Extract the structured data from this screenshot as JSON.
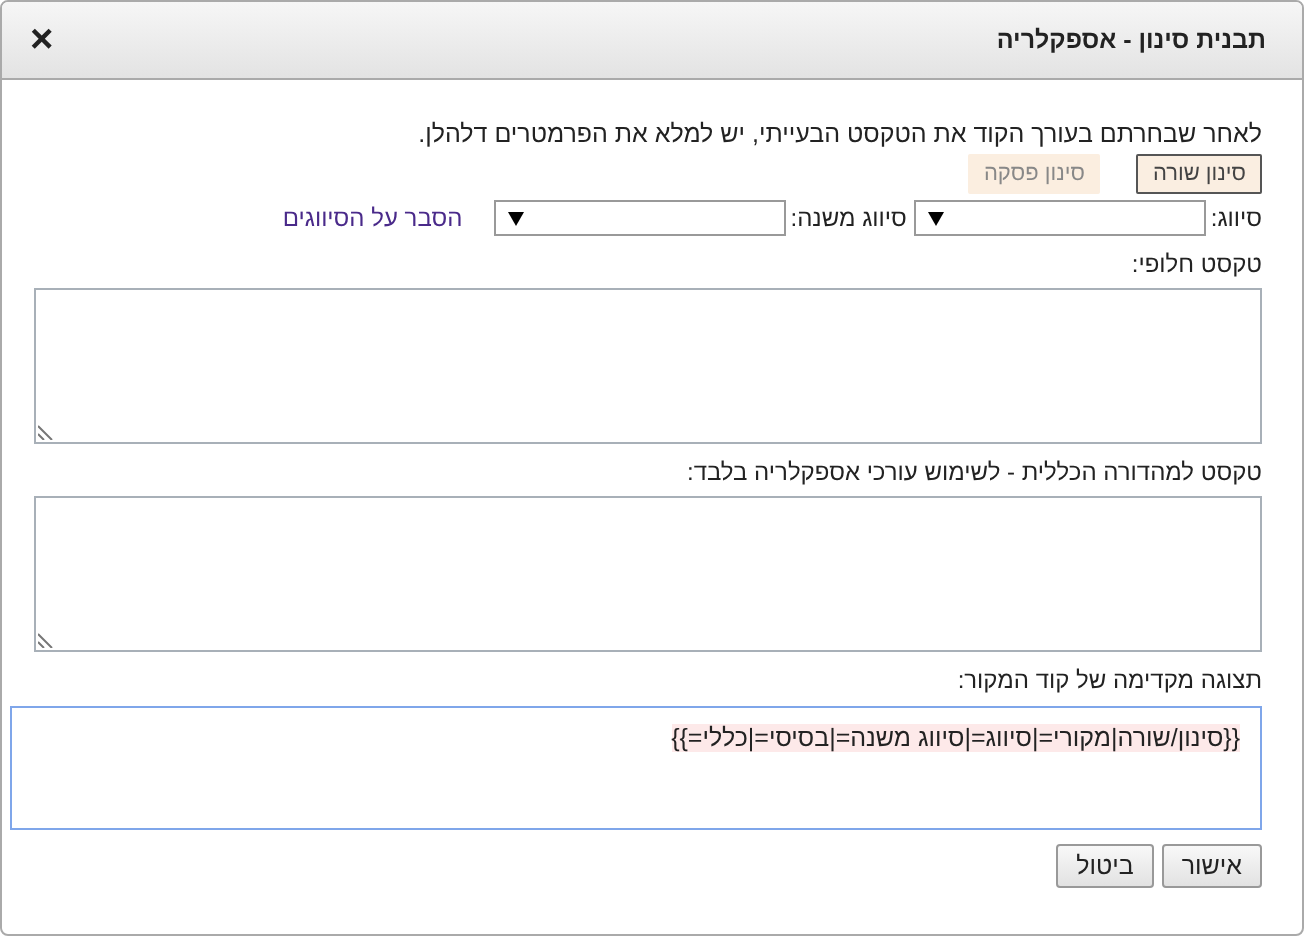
{
  "window": {
    "title": "תבנית סינון - אספקלריה",
    "close": "×"
  },
  "instructions": "לאחר שבחרתם בעורך הקוד את הטקסט הבעייתי, יש למלא את הפרמטרים דלהלן.",
  "modes": [
    {
      "label": "סינון שורה",
      "selected": true
    },
    {
      "label": "סינון פסקה",
      "selected": false
    }
  ],
  "classification": {
    "label": "סיווג:",
    "sub_label": "סיווג משנה:",
    "help_link": "הסבר על הסיווגים"
  },
  "fields": [
    {
      "label": "טקסט חלופי:"
    },
    {
      "label": "טקסט למהדורה הכללית - לשימוש עורכי אספקלריה בלבד:"
    }
  ],
  "preview": {
    "label": "תצוגה מקדימה של קוד המקור:",
    "code": "{{סינון/שורה|מקורי=|סיווג=|סיווג משנה=|בסיסי=|כללי=}}"
  },
  "buttons": [
    "אישור",
    "ביטול"
  ]
}
